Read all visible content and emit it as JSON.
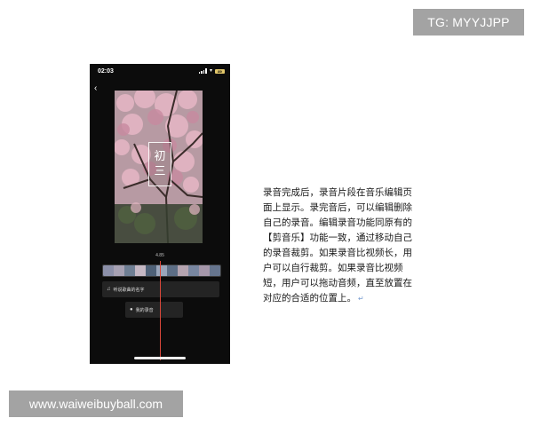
{
  "watermarks": {
    "tg": "TG: MYYJJPP",
    "site": "www.waiweibuyball.com"
  },
  "phone": {
    "status_bar": {
      "time": "02:03",
      "battery_text": "89"
    },
    "video_title": [
      "初",
      "三"
    ],
    "timeline": {
      "duration": "4.85",
      "music_track_label": "听说歌曲的名字",
      "voice_track_label": "我的录音"
    },
    "icons": {
      "back": "chevron-left-icon",
      "signal": "signal-icon",
      "wifi": "wifi-icon",
      "battery": "battery-icon",
      "music": "music-note-icon",
      "mic": "microphone-icon"
    },
    "colors": {
      "playhead": "#d9473a",
      "battery": "#e1c66a"
    }
  },
  "description": {
    "lines": [
      "录音完成后，录音片段在音乐编辑页",
      "面上显示。录完音后，可以编辑删除",
      "自己的录音。编辑录音功能同原有的",
      "【剪音乐】功能一致，通过移动自己",
      "的录音裁剪。如果录音比视频长，用",
      "户可以自行裁剪。如果录音比视频",
      "短，用户可以拖动音频，直至放置在",
      "对应的合适的位置上。"
    ],
    "end_mark": "↵"
  }
}
